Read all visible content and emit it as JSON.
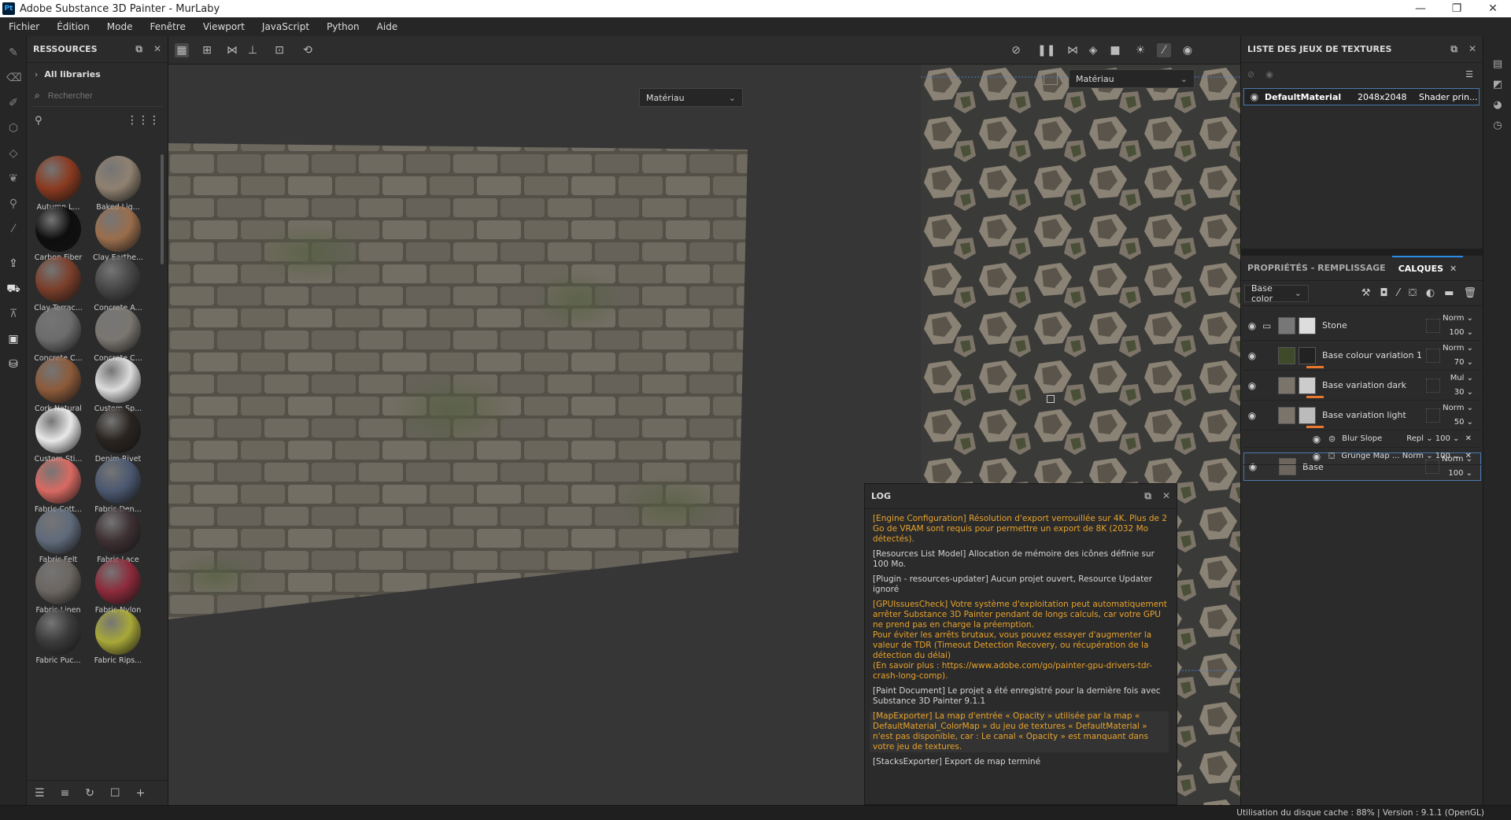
{
  "app": {
    "title": "Adobe Substance 3D Painter - MurLaby",
    "logo": "Pt"
  },
  "menu": [
    "Fichier",
    "Édition",
    "Mode",
    "Fenêtre",
    "Viewport",
    "JavaScript",
    "Python",
    "Aide"
  ],
  "resources": {
    "title": "RESSOURCES",
    "all_libraries": "All libraries",
    "search_placeholder": "Rechercher",
    "materials": [
      {
        "name": "Autumn L...",
        "color": "#8a3a20"
      },
      {
        "name": "Baked Lig...",
        "color": "#8f8170"
      },
      {
        "name": "Carbon Fiber",
        "color": "#0e0e0e"
      },
      {
        "name": "Clay Earthe...",
        "color": "#9a6e4c"
      },
      {
        "name": "Clay Terrac...",
        "color": "#7a3e2a"
      },
      {
        "name": "Concrete A...",
        "color": "#464646"
      },
      {
        "name": "Concrete C...",
        "color": "#6c6c6c"
      },
      {
        "name": "Concrete C...",
        "color": "#7a7670"
      },
      {
        "name": "Cork Natural",
        "color": "#8c5a3a"
      },
      {
        "name": "Custom Sp...",
        "color": "#dcdcdc"
      },
      {
        "name": "Custom Sti...",
        "color": "#e8e8e8"
      },
      {
        "name": "Denim Rivet",
        "color": "#2a2420"
      },
      {
        "name": "Fabric Cott...",
        "color": "#d86a62"
      },
      {
        "name": "Fabric Den...",
        "color": "#4b5870"
      },
      {
        "name": "Fabric Felt",
        "color": "#5f6a7a"
      },
      {
        "name": "Fabric Lace",
        "color": "#3d3033"
      },
      {
        "name": "Fabric Linen",
        "color": "#6a6560"
      },
      {
        "name": "Fabric Nylon",
        "color": "#8c2a3a"
      },
      {
        "name": "Fabric Puc...",
        "color": "#3a3a3a"
      },
      {
        "name": "Fabric Rips...",
        "color": "#a8a838"
      }
    ]
  },
  "viewport": {
    "left_select": "Matériau",
    "right_select": "Matériau"
  },
  "log": {
    "title": "LOG",
    "lines": [
      {
        "text": "[Engine Configuration] Résolution d'export verrouillée sur 4K. Plus de 2 Go de VRAM sont requis pour permettre un export de 8K (2032 Mo détectés).",
        "type": "warn"
      },
      {
        "text": "[Resources List Model] Allocation de mémoire des icônes définie sur 100 Mo.",
        "type": "info"
      },
      {
        "text": "[Plugin - resources-updater] Aucun projet ouvert, Resource Updater ignoré",
        "type": "info"
      },
      {
        "text": "[GPUIssuesCheck] Votre système d'exploitation peut automatiquement arrêter Substance 3D Painter pendant de longs calculs, car votre GPU ne prend pas en charge la préemption.\nPour éviter les arrêts brutaux, vous pouvez essayer d'augmenter la valeur de TDR (Timeout Detection Recovery, ou récupération de la détection du délai)\n(En savoir plus : https://www.adobe.com/go/painter-gpu-drivers-tdr-crash-long-comp).",
        "type": "warn"
      },
      {
        "text": "[Paint Document] Le projet a été enregistré pour la dernière fois avec Substance 3D Painter 9.1.1",
        "type": "info"
      },
      {
        "text": "[MapExporter] La map d'entrée « Opacity » utilisée par la map « DefaultMaterial_ColorMap » du jeu de textures « DefaultMaterial » n'est pas disponible, car : Le canal « Opacity » est manquant dans votre jeu de textures.",
        "type": "hl"
      },
      {
        "text": "[StacksExporter] Export de map terminé",
        "type": "info"
      }
    ]
  },
  "texture_sets": {
    "title": "LISTE DES JEUX DE TEXTURES",
    "rows": [
      {
        "name": "DefaultMaterial",
        "resolution": "2048x2048",
        "shader": "Shader prin..."
      }
    ]
  },
  "layers_panel": {
    "tab_properties": "PROPRIÉTÉS - REMPLISSAGE",
    "tab_layers": "CALQUES",
    "channel": "Base color",
    "layers": [
      {
        "name": "Stone",
        "blend": "Norm",
        "opacity": "100",
        "thumb": "#777",
        "mask": "#ddd",
        "orange": false,
        "folder": true,
        "selected": false
      },
      {
        "name": "Base colour variation 1",
        "blend": "Norm",
        "opacity": "70",
        "thumb": "#3e4a2a",
        "mask": "#222",
        "orange": true,
        "folder": false,
        "selected": false
      },
      {
        "name": "Base variation dark",
        "blend": "Mul",
        "opacity": "30",
        "thumb": "#7a746a",
        "mask": "#ccc",
        "orange": true,
        "folder": false,
        "selected": false
      },
      {
        "name": "Base variation light",
        "blend": "Norm",
        "opacity": "50",
        "thumb": "#7a746a",
        "mask": "#bbb",
        "orange": true,
        "folder": false,
        "selected": false
      },
      {
        "name": "Base",
        "blend": "Norm",
        "opacity": "100",
        "thumb": "#6c665e",
        "mask": "",
        "orange": false,
        "folder": false,
        "selected": true
      }
    ],
    "effects": [
      {
        "name": "Blur Slope",
        "blend": "Repl",
        "opacity": "100"
      },
      {
        "name": "Grunge Map ...",
        "blend": "Norm",
        "opacity": "100"
      }
    ]
  },
  "status": {
    "text": "Utilisation du disque cache :   88% | Version : 9.1.1 (OpenGL)"
  }
}
